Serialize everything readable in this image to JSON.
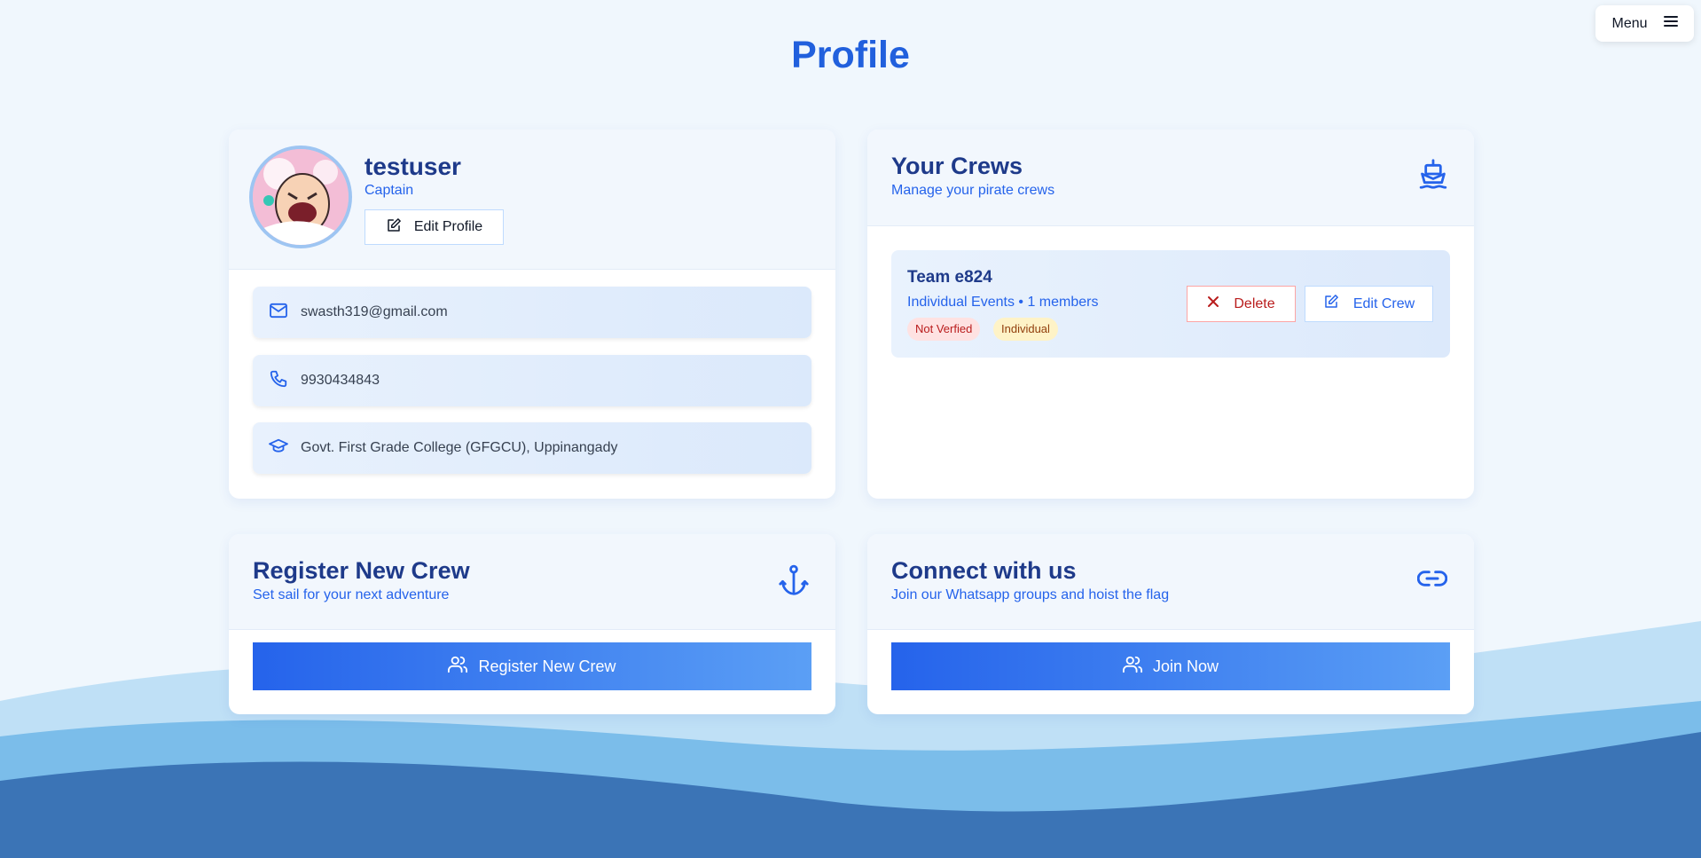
{
  "header": {
    "title": "Profile",
    "menu_label": "Menu"
  },
  "profile": {
    "username": "testuser",
    "role": "Captain",
    "edit_label": "Edit Profile",
    "email": "swasth319@gmail.com",
    "phone": "9930434843",
    "college": "Govt. First Grade College (GFGCU), Uppinangady"
  },
  "crews": {
    "title": "Your Crews",
    "subtitle": "Manage your pirate crews",
    "items": [
      {
        "name": "Team e824",
        "meta": "Individual Events • 1 members",
        "status_badge": "Not Verfied",
        "type_badge": "Individual",
        "delete_label": "Delete",
        "edit_label": "Edit Crew"
      }
    ]
  },
  "register": {
    "title": "Register New Crew",
    "subtitle": "Set sail for your next adventure",
    "button_label": "Register New Crew"
  },
  "connect": {
    "title": "Connect with us",
    "subtitle": "Join our Whatsapp groups and hoist the flag",
    "button_label": "Join Now"
  },
  "colors": {
    "accent": "#2563eb",
    "title": "#1e3a8a",
    "background": "#f0f7fd",
    "danger": "#b91c1c",
    "wave_dark": "#3b74b6",
    "wave_light": "#7bbdea"
  }
}
